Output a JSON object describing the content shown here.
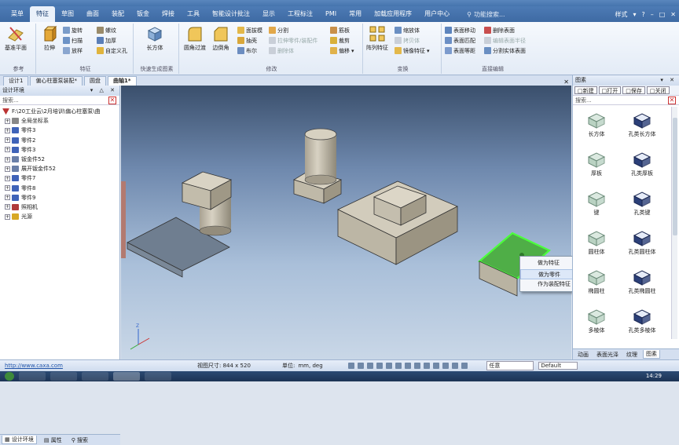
{
  "menubar": {
    "tabs": [
      "菜单",
      "特征",
      "草图",
      "曲面",
      "装配",
      "钣金",
      "焊接",
      "工具",
      "智能设计批注",
      "显示",
      "工程标注",
      "PMI",
      "常用",
      "加载应用程序",
      "用户中心"
    ],
    "active_tab": "特征",
    "search_placeholder": "功能搜索...",
    "style_label": "样式"
  },
  "ribbon": {
    "groups": {
      "reference": "参考",
      "feature": "特征",
      "quick": "快速生成图素",
      "modify": "修改",
      "transform": "变换",
      "direct_edit": "直接编辑"
    },
    "buttons": {
      "datum_plane": "基准平面",
      "extrude": "拉伸",
      "revolve": "旋转",
      "sweep": "扫描",
      "loft": "放样",
      "thread": "螺纹",
      "thicken": "加厚",
      "custom_hole": "自定义孔",
      "box": "长方体",
      "fillet": "圆角过渡",
      "chamfer": "边倒角",
      "draft": "面拔模",
      "shell": "抽壳",
      "boolean": "布尔",
      "split": "分割",
      "stretch_part": "拉伸零件/装配件",
      "delete_body": "删除体",
      "rib": "筋板",
      "crop": "裁剪",
      "offset": "偏移",
      "array_feature": "阵列特征",
      "scale_body": "缩放体",
      "copy_body": "拷贝体",
      "mirror_feature": "镜像特征",
      "face_move": "表面移动",
      "face_match": "表面匹配",
      "face_offset": "表面等距",
      "delete_face": "删除表面",
      "edit_face_radius": "编辑表面半径",
      "split_solid_face": "分割实体表面"
    }
  },
  "doc_tabs": [
    "设计1",
    "偏心柱塞泵装配*",
    "圆盘",
    "曲轴1*"
  ],
  "doc_tabs_active": "曲轴1*",
  "left_panel": {
    "title": "设计环境",
    "search_placeholder": "搜索...",
    "root": "F:\\20工业云\\2月培训\\偏心柱塞泵\\曲",
    "items": [
      {
        "label": "全局坐标系",
        "color": "#888888"
      },
      {
        "label": "零件3",
        "color": "#3f63b8"
      },
      {
        "label": "零件2",
        "color": "#3f63b8"
      },
      {
        "label": "零件3",
        "color": "#3f63b8"
      },
      {
        "label": "钣金件52",
        "color": "#6a7fa8"
      },
      {
        "label": "展开钣金件52",
        "color": "#6a7fa8"
      },
      {
        "label": "零件7",
        "color": "#3f63b8"
      },
      {
        "label": "零件8",
        "color": "#3f63b8"
      },
      {
        "label": "零件9",
        "color": "#3f63b8"
      },
      {
        "label": "照相机",
        "color": "#b03a3a"
      },
      {
        "label": "光源",
        "color": "#d7a825"
      }
    ],
    "bottom_tabs": [
      "设计环境",
      "属性",
      "搜索"
    ]
  },
  "context_menu": {
    "items": [
      "做为特征",
      "做为零件",
      "作为装配特征"
    ],
    "highlighted": "做为零件"
  },
  "right_panel": {
    "title": "图素",
    "toolbar": [
      "新建",
      "打开",
      "保存",
      "关闭"
    ],
    "search_placeholder": "搜索...",
    "items": [
      {
        "label": "长方体",
        "kind": "solid"
      },
      {
        "label": "孔类长方体",
        "kind": "hole"
      },
      {
        "label": "厚板",
        "kind": "solid"
      },
      {
        "label": "孔类厚板",
        "kind": "hole"
      },
      {
        "label": "键",
        "kind": "solid"
      },
      {
        "label": "孔类键",
        "kind": "hole"
      },
      {
        "label": "圆柱体",
        "kind": "solid"
      },
      {
        "label": "孔类圆柱体",
        "kind": "hole"
      },
      {
        "label": "椭圆柱",
        "kind": "solid"
      },
      {
        "label": "孔类椭圆柱",
        "kind": "hole"
      },
      {
        "label": "多棱体",
        "kind": "solid"
      },
      {
        "label": "孔类多棱体",
        "kind": "hole"
      }
    ],
    "bottom_tabs": [
      "动画",
      "表面光泽",
      "纹理",
      "图素"
    ],
    "bottom_tabs_active": "图素"
  },
  "statusbar": {
    "url": "http://www.caxa.com",
    "viewport_label": "视图尺寸: 844 x 520",
    "unit_label": "单位:",
    "unit_value": "mm, deg",
    "select_mode": "任意",
    "scheme": "Default"
  },
  "taskbar": {
    "clock": "14:29"
  }
}
